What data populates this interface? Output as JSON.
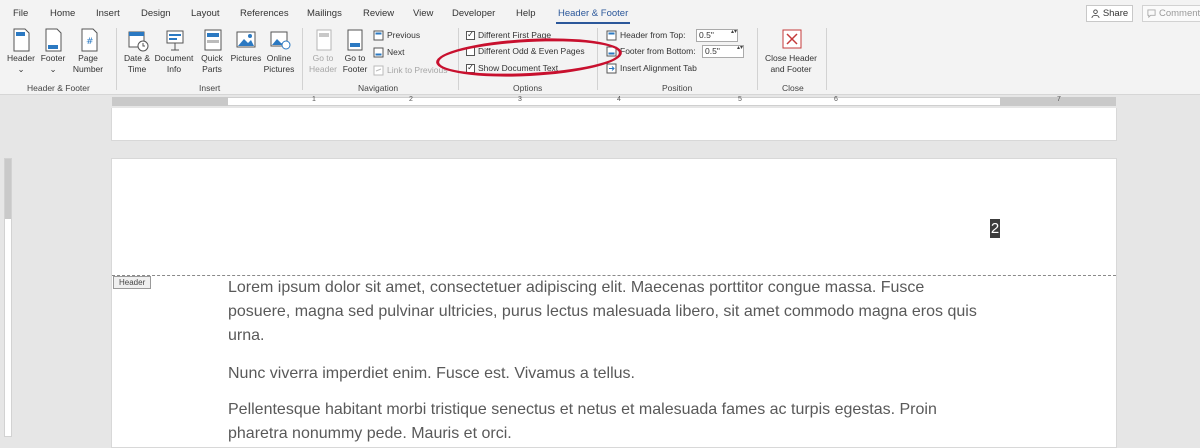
{
  "menu": {
    "tabs": [
      "File",
      "Home",
      "Insert",
      "Design",
      "Layout",
      "References",
      "Mailings",
      "Review",
      "View",
      "Developer",
      "Help",
      "Header & Footer"
    ],
    "active_tab": "Header & Footer",
    "share_label": "Share",
    "comments_label": "Comments"
  },
  "ribbon": {
    "header_footer": {
      "header_label": "Header",
      "footer_label": "Footer",
      "page_number_label": "Page Number",
      "group_label": "Header & Footer"
    },
    "insert": {
      "date_time_label": "Date & Time",
      "document_info_label": "Document Info",
      "quick_parts_label": "Quick Parts",
      "pictures_label": "Pictures",
      "online_pictures_label": "Online Pictures",
      "group_label": "Insert"
    },
    "navigation": {
      "go_to_header_label": "Go to Header",
      "go_to_footer_label": "Go to Footer",
      "previous_label": "Previous",
      "next_label": "Next",
      "link_to_previous_label": "Link to Previous",
      "group_label": "Navigation"
    },
    "options": {
      "different_first_page_label": "Different First Page",
      "different_first_page_checked": true,
      "different_odd_even_label": "Different Odd & Even Pages",
      "different_odd_even_checked": false,
      "show_document_text_label": "Show Document Text",
      "show_document_text_checked": true,
      "group_label": "Options"
    },
    "position": {
      "header_from_top_label": "Header from Top:",
      "header_from_top_value": "0.5\"",
      "footer_from_bottom_label": "Footer from Bottom:",
      "footer_from_bottom_value": "0.5\"",
      "insert_alignment_tab_label": "Insert Alignment Tab",
      "group_label": "Position"
    },
    "close": {
      "close_label": "Close Header and Footer",
      "group_label": "Close"
    }
  },
  "ruler": {
    "numbers": [
      "1",
      "2",
      "3",
      "4",
      "5",
      "6",
      "7"
    ]
  },
  "document": {
    "header_tag": "Header",
    "page_number": "2",
    "paragraphs": [
      "Lorem ipsum dolor sit amet, consectetuer adipiscing elit. Maecenas porttitor congue massa. Fusce posuere, magna sed pulvinar ultricies, purus lectus malesuada libero, sit amet commodo magna eros quis urna.",
      "Nunc viverra imperdiet enim. Fusce est. Vivamus a tellus.",
      "Pellentesque habitant morbi tristique senectus et netus et malesuada fames ac turpis egestas. Proin pharetra nonummy pede. Mauris et orci."
    ]
  },
  "colors": {
    "accent": "#2b579a",
    "annotation": "#c8102e"
  }
}
